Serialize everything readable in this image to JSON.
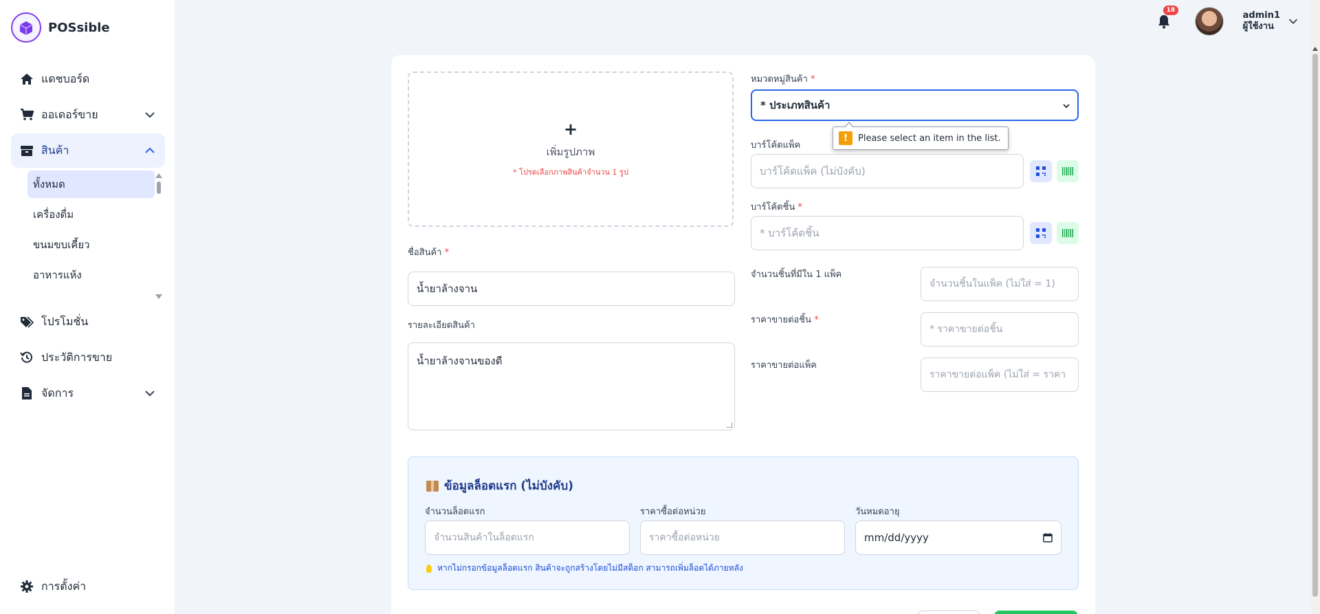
{
  "brand": {
    "name": "POSsible"
  },
  "sidebar": {
    "items": [
      {
        "label": "แดชบอร์ด",
        "icon": "home-icon"
      },
      {
        "label": "ออเดอร์ขาย",
        "icon": "cart-icon"
      },
      {
        "label": "สินค้า",
        "icon": "box-icon"
      }
    ],
    "subitems": [
      {
        "label": "ทั้งหมด"
      },
      {
        "label": "เครื่องดื่ม"
      },
      {
        "label": "ขนมขบเคี้ยว"
      },
      {
        "label": "อาหารแห้ง"
      }
    ],
    "items2": [
      {
        "label": "โปรโมชั่น",
        "icon": "tag-icon"
      },
      {
        "label": "ประวัติการขาย",
        "icon": "history-icon"
      },
      {
        "label": "จัดการ",
        "icon": "document-icon"
      }
    ],
    "settings": {
      "label": "การตั้งค่า",
      "icon": "gear-icon"
    }
  },
  "header": {
    "notification_count": "18",
    "user_name": "admin1",
    "user_role": "ผู้ใช้งาน"
  },
  "form": {
    "image": {
      "plus": "+",
      "title": "เพิ่มรูปภาพ",
      "note": "* โปรดเลือกภาพสินค้าจำนวน 1 รูป"
    },
    "product_name": {
      "label": "ชื่อสินค้า",
      "required": "*",
      "value": "น้ำยาล้างจาน"
    },
    "description": {
      "label": "รายละเอียดสินค้า",
      "value": "น้ำยาล้างจานของดี"
    },
    "category": {
      "label": "หมวดหมู่สินค้า",
      "required": "*",
      "selected": "* ประเภทสินค้า"
    },
    "pack_barcode": {
      "label": "บาร์โค้ดแพ็ค",
      "placeholder": "บาร์โค้ดแพ็ค (ไม่บังคับ)"
    },
    "unit_barcode": {
      "label": "บาร์โค้ดชิ้น",
      "required": "*",
      "placeholder": "* บาร์โค้ดชิ้น"
    },
    "units_per_pack": {
      "label": "จำนวนชิ้นที่มีใน 1 แพ็ค",
      "placeholder": "จำนวนชิ้นในแพ็ค (ไม่ใส่ = 1)"
    },
    "unit_price": {
      "label": "ราคาขายต่อชิ้น",
      "required": "*",
      "placeholder": "* ราคาขายต่อชิ้น"
    },
    "pack_price": {
      "label": "ราคาขายต่อแพ็ค",
      "placeholder": "ราคาขายต่อแพ็ค (ไม่ใส่ = ราคา"
    },
    "tooltip": "Please select an item in the list."
  },
  "lot": {
    "title": "ข้อมูลล็อตแรก (ไม่บังคับ)",
    "qty": {
      "label": "จำนวนล็อตแรก",
      "placeholder": "จำนวนสินค้าในล็อตแรก"
    },
    "cost": {
      "label": "ราคาซื้อต่อหน่วย",
      "placeholder": "ราคาซื้อต่อหน่วย"
    },
    "expiry": {
      "label": "วันหมดอายุ",
      "placeholder": "mm/dd/yyyy"
    },
    "note": "หากไม่กรอกข้อมูลล็อตแรก สินค้าจะถูกสร้างโดยไม่มีสต็อก สามารถเพิ่มล็อตได้ภายหลัง"
  },
  "colors": {
    "accent": "#2563eb",
    "brand": "#7c3aed",
    "danger": "#ef4444",
    "success": "#22c55e"
  }
}
